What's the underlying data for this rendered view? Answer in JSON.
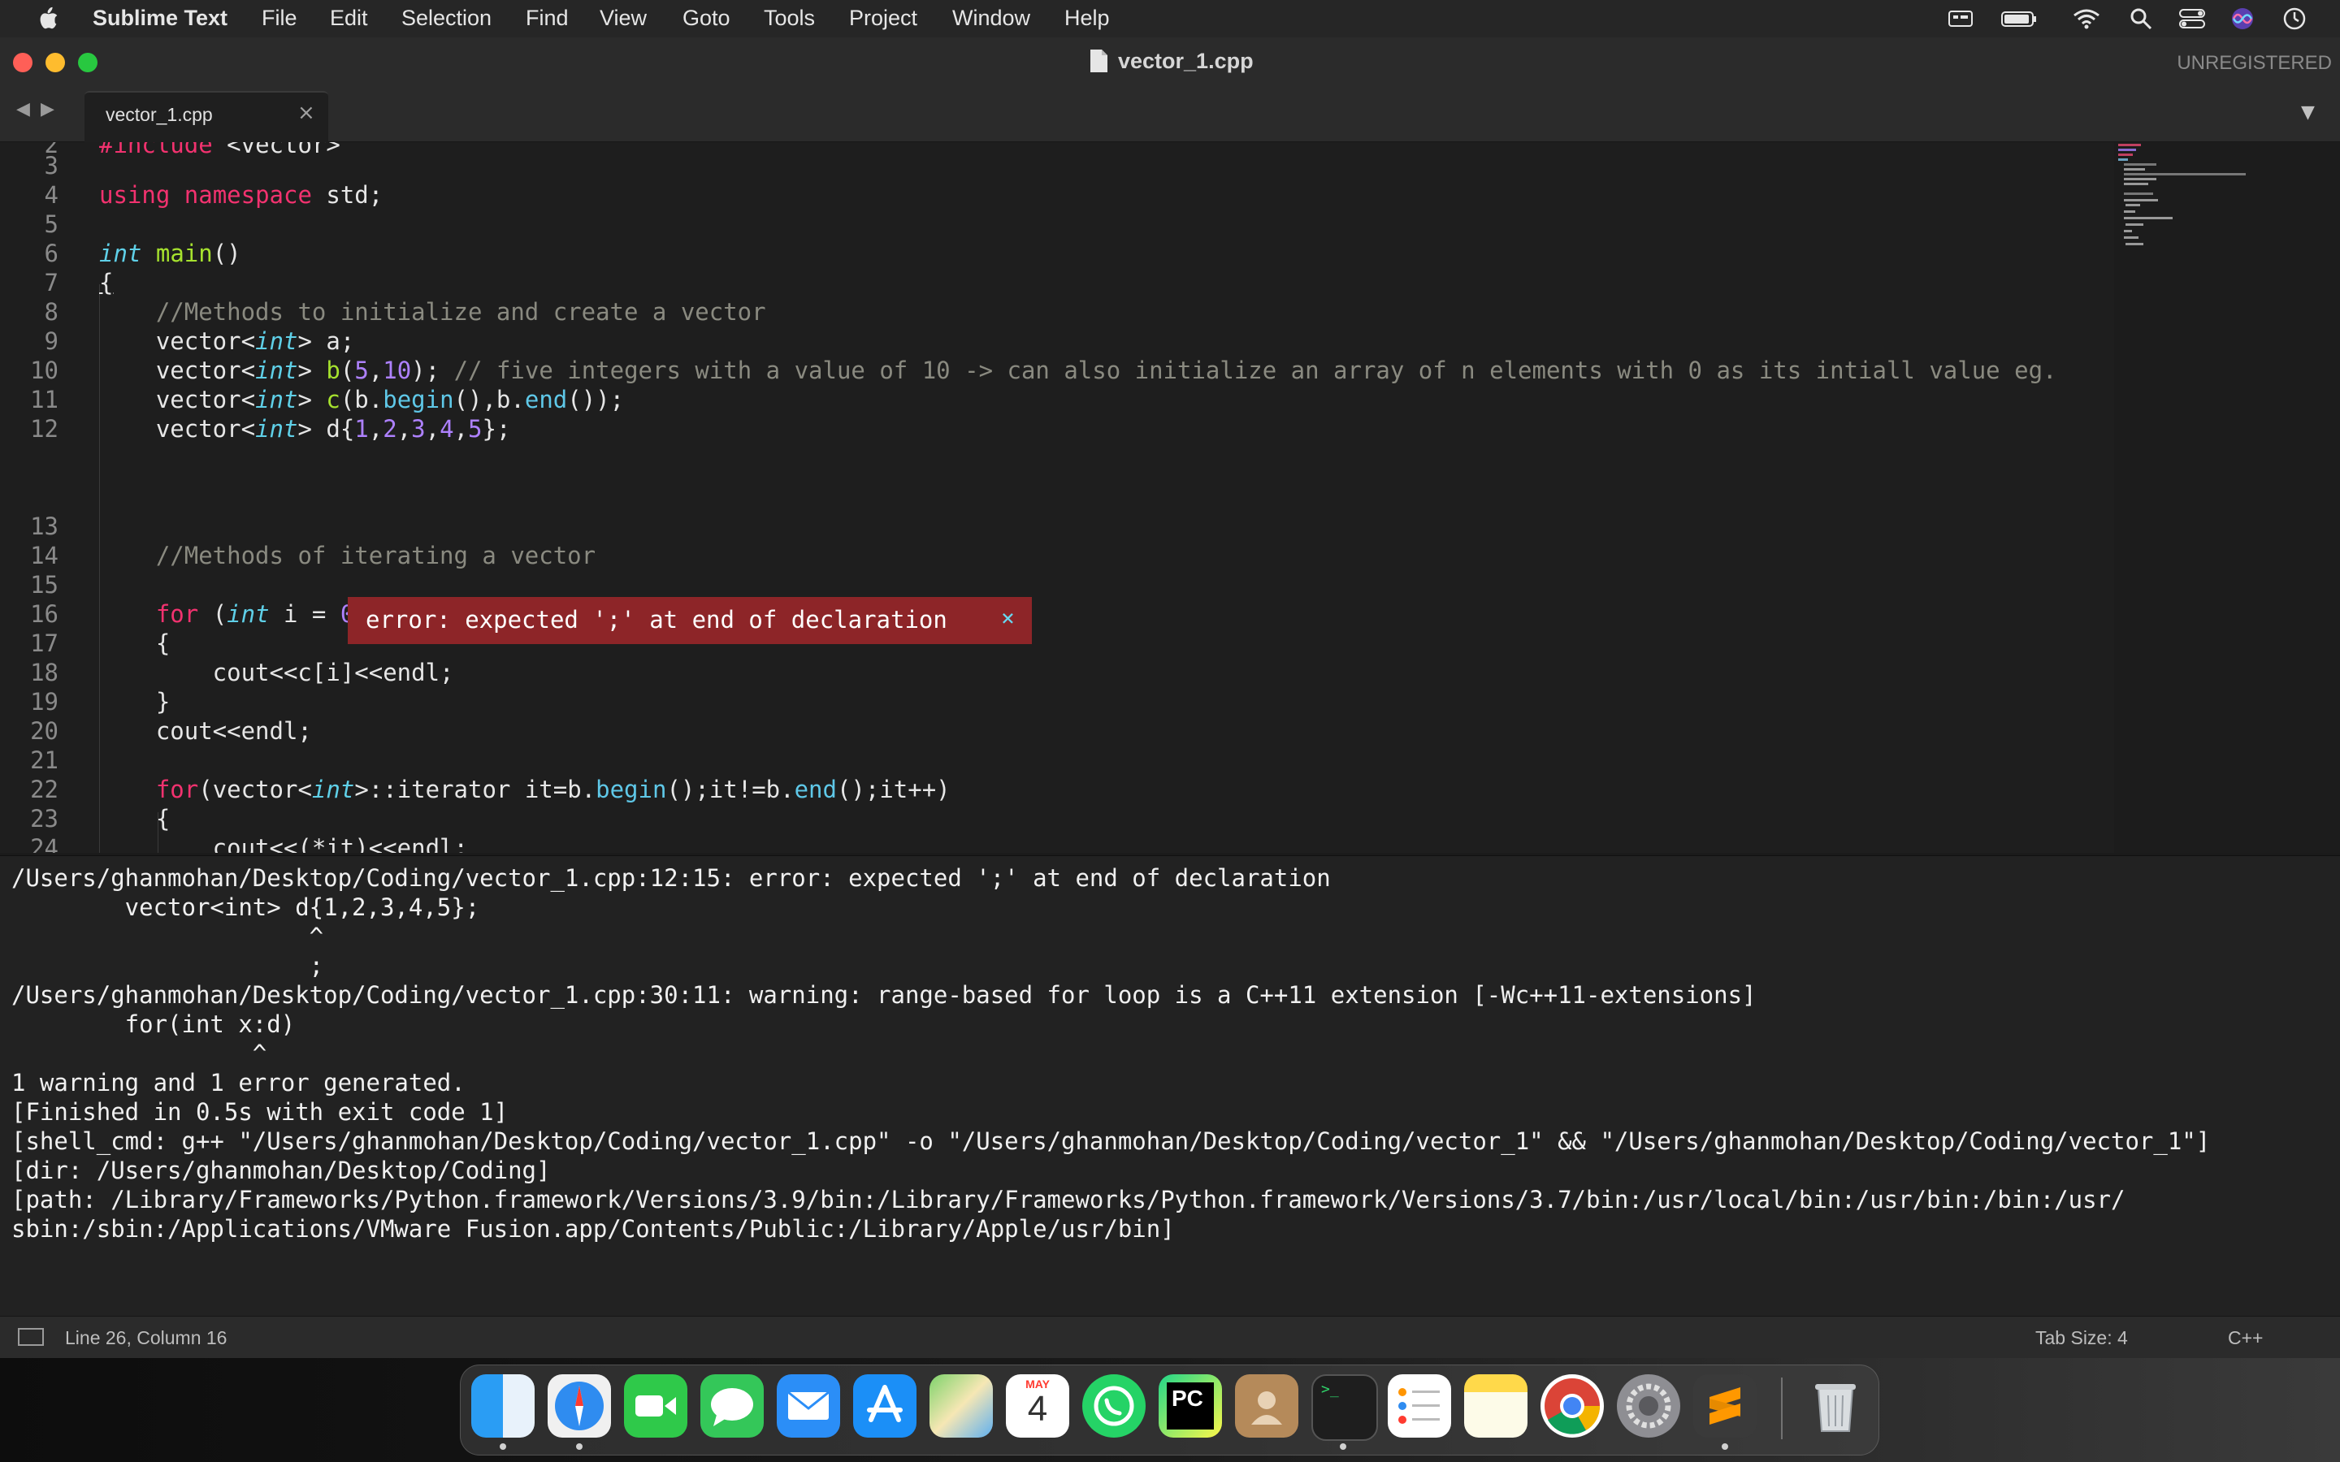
{
  "menubar": {
    "app_name": "Sublime Text",
    "items": [
      "File",
      "Edit",
      "Selection",
      "Find",
      "View",
      "Goto",
      "Tools",
      "Project",
      "Window",
      "Help"
    ]
  },
  "window": {
    "title": "vector_1.cpp",
    "registration": "UNREGISTERED"
  },
  "tabs": [
    {
      "label": "vector_1.cpp",
      "active": true
    }
  ],
  "editor": {
    "error_popup": "error: expected ';' at end of declaration",
    "top_partial_line": "#include <vector>"
  },
  "build_output": [
    "/Users/ghanmohan/Desktop/Coding/vector_1.cpp:12:15: error: expected ';' at end of declaration",
    "        vector<int> d{1,2,3,4,5};",
    "                     ^",
    "                     ;",
    "/Users/ghanmohan/Desktop/Coding/vector_1.cpp:30:11: warning: range-based for loop is a C++11 extension [-Wc++11-extensions]",
    "        for(int x:d)",
    "                 ^",
    "1 warning and 1 error generated.",
    "[Finished in 0.5s with exit code 1]",
    "[shell_cmd: g++ \"/Users/ghanmohan/Desktop/Coding/vector_1.cpp\" -o \"/Users/ghanmohan/Desktop/Coding/vector_1\" && \"/Users/ghanmohan/Desktop/Coding/vector_1\"]",
    "[dir: /Users/ghanmohan/Desktop/Coding]",
    "[path: /Library/Frameworks/Python.framework/Versions/3.9/bin:/Library/Frameworks/Python.framework/Versions/3.7/bin:/usr/local/bin:/usr/bin:/bin:/usr/",
    "sbin:/sbin:/Applications/VMware Fusion.app/Contents/Public:/Library/Apple/usr/bin]"
  ],
  "statusbar": {
    "position": "Line 26, Column 16",
    "tab_size": "Tab Size: 4",
    "syntax": "C++"
  },
  "dock": {
    "calendar_month": "MAY",
    "calendar_day": "4",
    "apps": [
      "Finder",
      "Safari",
      "FaceTime",
      "Messages",
      "Mail",
      "App Store",
      "Maps",
      "Calendar",
      "WhatsApp",
      "PyCharm",
      "Contacts",
      "Terminal",
      "Reminders",
      "Notes",
      "Chrome",
      "System Preferences",
      "Sublime Text",
      "Trash"
    ]
  },
  "colors": {
    "keyword": "#f2326f",
    "type": "#5fd0e8",
    "function": "#a6e22e",
    "number": "#ae81ff",
    "comment": "#8a8a80",
    "error_bg": "#8d2528"
  }
}
